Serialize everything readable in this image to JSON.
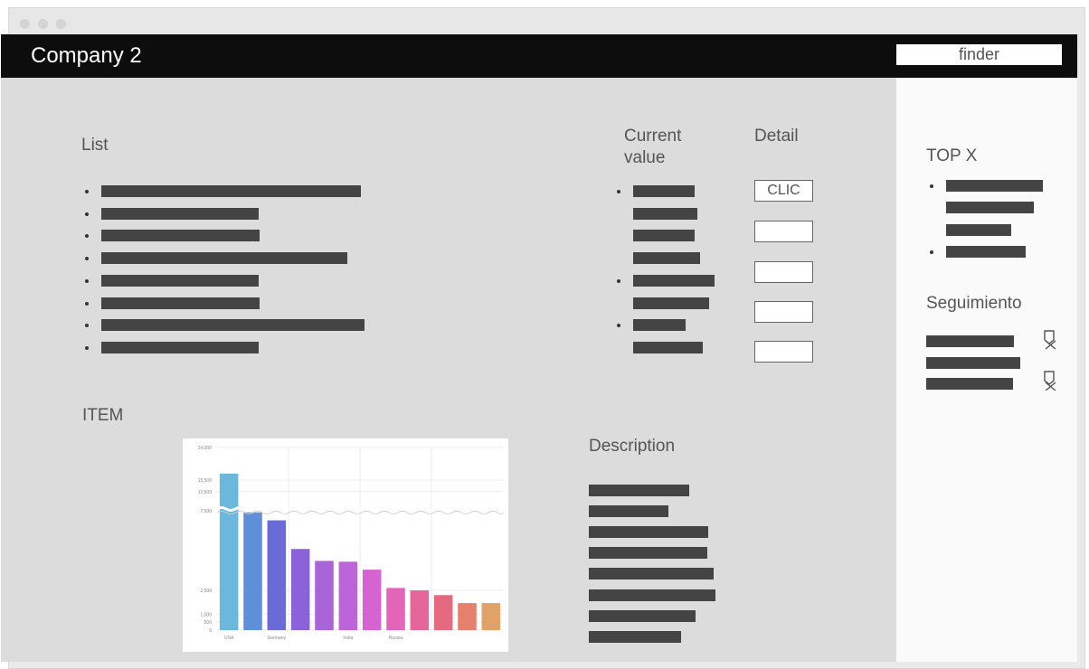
{
  "window": {
    "dot_color": "#d4d4d4"
  },
  "header": {
    "title": "Company 2",
    "finder_placeholder": "finder"
  },
  "list": {
    "heading": "List",
    "items": 8
  },
  "current_value": {
    "heading": "Current value"
  },
  "detail": {
    "heading": "Detail",
    "button_label": "CLIC",
    "empty_boxes": 4
  },
  "item": {
    "heading": "ITEM"
  },
  "description": {
    "heading": "Description"
  },
  "sidebar": {
    "top_heading": "TOP X",
    "follow_heading": "Seguimiento"
  },
  "icons": {
    "pin": "pin-outline-icon",
    "pin_off": "pin-off-icon"
  },
  "colors": {
    "header_bg": "#0d0d0d",
    "main_bg": "#dcdcdc",
    "bars": "#444444"
  },
  "chart_data": {
    "type": "bar",
    "categories": [
      "USA",
      "",
      "Germany",
      "",
      "",
      "India",
      "",
      "Russia",
      "",
      "",
      "",
      ""
    ],
    "values": [
      17200,
      7400,
      6900,
      5100,
      4350,
      4300,
      3800,
      2650,
      2500,
      2200,
      1700,
      1700
    ],
    "colors": [
      "#6cb8dc",
      "#5f8fd9",
      "#6a6bd9",
      "#8a62d9",
      "#a864d8",
      "#bc64d8",
      "#d564d2",
      "#e364b9",
      "#e7669a",
      "#e56a80",
      "#e5806f",
      "#e0a266"
    ],
    "yticks": [
      "24,000",
      "15,500",
      "12,500",
      "7,500",
      "2,500",
      "1,000",
      "500",
      "0"
    ],
    "broken_axis": true,
    "grid": true
  }
}
